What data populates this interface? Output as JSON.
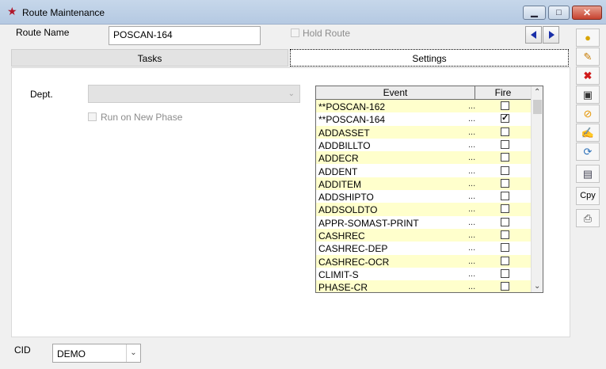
{
  "window": {
    "title": "Route Maintenance"
  },
  "form": {
    "route_name_label": "Route Name",
    "route_name_value": "POSCAN-164",
    "hold_route_label": "Hold Route",
    "dept_label": "Dept.",
    "dept_value": "",
    "run_on_new_phase_label": "Run on New Phase",
    "cid_label": "CID",
    "cid_value": "DEMO"
  },
  "tabs": {
    "tasks": "Tasks",
    "settings": "Settings"
  },
  "events_grid": {
    "col_event": "Event",
    "col_fire": "Fire",
    "rows": [
      {
        "name": "**POSCAN-162",
        "dots": "...",
        "fire": false
      },
      {
        "name": "**POSCAN-164",
        "dots": "...",
        "fire": true
      },
      {
        "name": "ADDASSET",
        "dots": "...",
        "fire": false
      },
      {
        "name": "ADDBILLTO",
        "dots": "...",
        "fire": false
      },
      {
        "name": "ADDECR",
        "dots": "...",
        "fire": false
      },
      {
        "name": "ADDENT",
        "dots": "...",
        "fire": false
      },
      {
        "name": "ADDITEM",
        "dots": "...",
        "fire": false
      },
      {
        "name": "ADDSHIPTO",
        "dots": "...",
        "fire": false
      },
      {
        "name": "ADDSOLDTO",
        "dots": "...",
        "fire": false
      },
      {
        "name": "APPR-SOMAST-PRINT",
        "dots": "...",
        "fire": false
      },
      {
        "name": "CASHREC",
        "dots": "...",
        "fire": false
      },
      {
        "name": "CASHREC-DEP",
        "dots": "...",
        "fire": false
      },
      {
        "name": "CASHREC-OCR",
        "dots": "...",
        "fire": false
      },
      {
        "name": "CLIMIT-S",
        "dots": "...",
        "fire": false
      },
      {
        "name": "PHASE-CR",
        "dots": "...",
        "fire": false
      }
    ]
  },
  "toolbar": {
    "copy_label": "Cpy"
  },
  "colors": {
    "alt_row": "#ffffcc",
    "nav_arrow": "#1a2fa8",
    "close_button": "#c6422f"
  }
}
